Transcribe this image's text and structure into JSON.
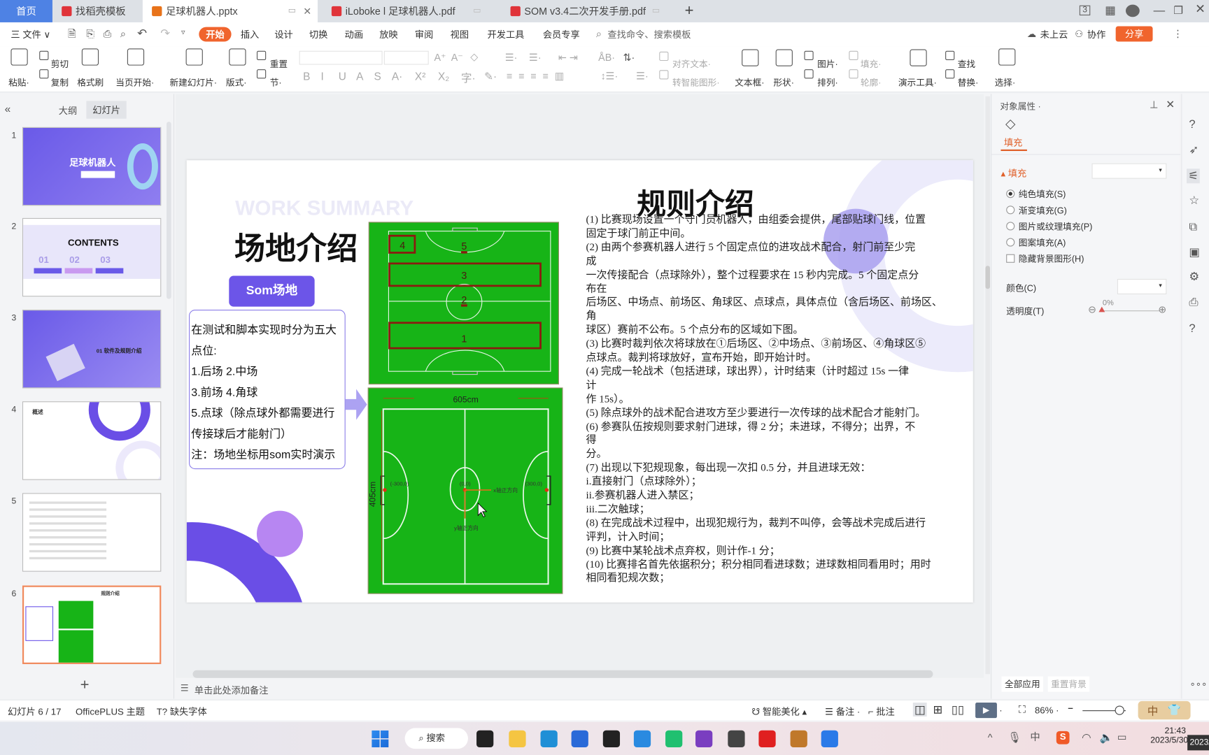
{
  "window_tabs": [
    {
      "label": "首页",
      "kind": "home"
    },
    {
      "label": "找稻壳模板",
      "kind": "docer"
    },
    {
      "label": "足球机器人.pptx",
      "kind": "pptx",
      "active": true
    },
    {
      "label": "iLoboke l 足球机器人.pdf",
      "kind": "pdf"
    },
    {
      "label": "SOM v3.4二次开发手册.pdf",
      "kind": "pdf"
    }
  ],
  "new_tab_label": "+",
  "menu": {
    "file": "三 文件 ∨",
    "items": [
      "开始",
      "插入",
      "设计",
      "切换",
      "动画",
      "放映",
      "审阅",
      "视图",
      "开发工具",
      "会员专享"
    ],
    "active": "开始",
    "search_placeholder": "查找命令、搜索模板",
    "cloud": "未上云",
    "collab": "协作",
    "share": "分享"
  },
  "ribbon": {
    "items": [
      "粘贴·",
      "剪切",
      "复制",
      "格式刷",
      "当页开始·",
      "新建幻灯片·",
      "版式·",
      "重置",
      "节·",
      "对齐文本·",
      "转智能图形·",
      "文本框·",
      "形状·",
      "图片·",
      "排列·",
      "填充·",
      "轮廓·",
      "演示工具·",
      "查找",
      "替换·",
      "选择·"
    ],
    "disabled": [
      "对齐文本·",
      "转智能图形·",
      "填充·",
      "轮廓·"
    ],
    "font_buttons": [
      "B",
      "I",
      "U",
      "A",
      "S",
      "A·",
      "X²",
      "X₂",
      "字·",
      "✎·"
    ]
  },
  "slide_panel": {
    "tabs": [
      "大纲",
      "幻灯片"
    ],
    "active_tab": "幻灯片",
    "slides": [
      {
        "num": "1",
        "title": "足球机器人"
      },
      {
        "num": "2",
        "title": "CONTENTS",
        "items": [
          "01",
          "02",
          "03"
        ]
      },
      {
        "num": "3",
        "title": "01 软件及规则介绍"
      },
      {
        "num": "4",
        "title": "概述"
      },
      {
        "num": "5",
        "title": ""
      },
      {
        "num": "6",
        "title": "规则介绍",
        "selected": true
      }
    ],
    "add_label": "+"
  },
  "slide": {
    "watermark": "WORK SUMMARY",
    "title": "场地介绍",
    "som_button": "Som场地",
    "box_lines": [
      "在测试和脚本实现时分为五大",
      "点位:",
      "1.后场        2.中场",
      "3.前场        4.角球",
      "5.点球（除点球外都需要进行",
      "传接球后才能射门）",
      "注：场地坐标用som实时演示"
    ],
    "zones": [
      "4",
      "5",
      "3",
      "2",
      "1"
    ],
    "field": {
      "width_label": "605cm",
      "height_label": "405cm",
      "left_point": "(-300,0)",
      "center_point": "(0,0)",
      "right_point": "(300,0)",
      "x_axis": "x轴正方向",
      "y_axis": "y轴正方向"
    },
    "rules_title": "规则介绍",
    "rules": [
      "(1) 比赛现场设置一个守门员机器人，由组委会提供，尾部贴球门线，位置",
      "固定于球门前正中间。",
      "(2) 由两个参赛机器人进行 5 个固定点位的进攻战术配合，射门前至少完",
      "成",
      "一次传接配合（点球除外），整个过程要求在 15 秒内完成。5 个固定点分",
      "布在",
      "后场区、中场点、前场区、角球区、点球点，具体点位（含后场区、前场区、",
      "角",
      "球区）赛前不公布。5 个点分布的区域如下图。",
      "(3) 比赛时裁判依次将球放在①后场区、②中场点、③前场区、④角球区⑤",
      "点球点。裁判将球放好，宣布开始，即开始计时。",
      "(4) 完成一轮战术（包括进球，球出界），计时结束（计时超过 15s 一律",
      "计",
      "作 15s）。",
      "(5) 除点球外的战术配合进攻方至少要进行一次传球的战术配合才能射门。",
      "(6) 参赛队伍按规则要求射门进球，得 2 分；未进球，不得分；出界，不",
      "得",
      "分。",
      "(7) 出现以下犯规现象，每出现一次扣 0.5 分，并且进球无效：",
      "i.直接射门（点球除外）；",
      "ii.参赛机器人进入禁区；",
      "iii.二次触球；",
      "(8) 在完成战术过程中，出现犯规行为，裁判不叫停，会等战术完成后进行",
      "评判，计入时间；",
      "(9) 比赛中某轮战术点弃权，则计作-1 分；",
      "(10) 比赛排名首先依据积分；积分相同看进球数；进球数相同看用时；用时",
      "相同看犯规次数；"
    ]
  },
  "notes_placeholder": "单击此处添加备注",
  "properties": {
    "header": "对象属性 ·",
    "tab": "填充",
    "section": "填充",
    "options": [
      {
        "label": "纯色填充(S)",
        "type": "radio",
        "checked": true
      },
      {
        "label": "渐变填充(G)",
        "type": "radio",
        "checked": false
      },
      {
        "label": "图片或纹理填充(P)",
        "type": "radio",
        "checked": false
      },
      {
        "label": "图案填充(A)",
        "type": "radio",
        "checked": false
      },
      {
        "label": "隐藏背景图形(H)",
        "type": "checkbox",
        "checked": false
      }
    ],
    "color_label": "颜色(C)",
    "transparency_label": "透明度(T)",
    "transparency_value": "0%",
    "transparency_percent": 0,
    "apply_all": "全部应用",
    "reset_bg": "重置背景"
  },
  "status": {
    "slide_count": "幻灯片 6 / 17",
    "theme": "OfficePLUS 主题",
    "missing_font": "缺失字体",
    "beautify": "智能美化 ▴",
    "notes": "备注 ·",
    "comments": "批注",
    "zoom": "86% ·",
    "zoom_percent": 86,
    "ime": "中"
  },
  "taskbar": {
    "search": "搜索",
    "tray_ime": "中",
    "time": "21:43",
    "date": "2023/5/30",
    "date_partial": "2023/"
  },
  "colors": {
    "accent": "#f0642d",
    "purple": "#6c55e8",
    "field_green": "#17b417",
    "zone_red": "#8b1a10",
    "home_tab": "#4e82e4"
  }
}
